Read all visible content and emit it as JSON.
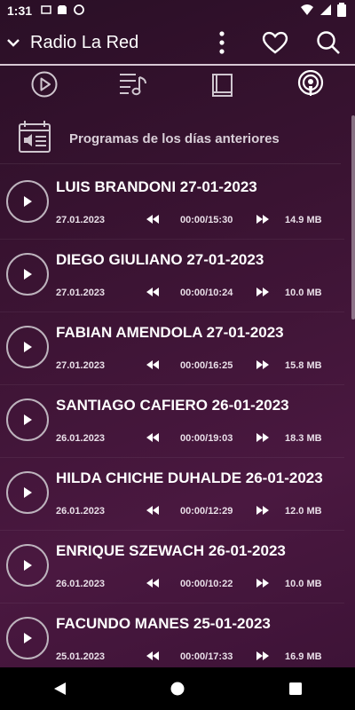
{
  "status_bar": {
    "time": "1:31"
  },
  "app_bar": {
    "title": "Radio La Red"
  },
  "section": {
    "label": "Programas de los días anteriores"
  },
  "items": [
    {
      "title": "LUIS BRANDONI 27-01-2023",
      "date": "27.01.2023",
      "time": "00:00/15:30",
      "size": "14.9 MB"
    },
    {
      "title": "DIEGO GIULIANO 27-01-2023",
      "date": "27.01.2023",
      "time": "00:00/10:24",
      "size": "10.0 MB"
    },
    {
      "title": "FABIAN AMENDOLA 27-01-2023",
      "date": "27.01.2023",
      "time": "00:00/16:25",
      "size": "15.8 MB"
    },
    {
      "title": "SANTIAGO CAFIERO 26-01-2023",
      "date": "26.01.2023",
      "time": "00:00/19:03",
      "size": "18.3 MB"
    },
    {
      "title": "HILDA CHICHE DUHALDE 26-01-2023",
      "date": "26.01.2023",
      "time": "00:00/12:29",
      "size": "12.0 MB"
    },
    {
      "title": "ENRIQUE SZEWACH 26-01-2023",
      "date": "26.01.2023",
      "time": "00:00/10:22",
      "size": "10.0 MB"
    },
    {
      "title": "FACUNDO MANES 25-01-2023",
      "date": "25.01.2023",
      "time": "00:00/17:33",
      "size": "16.9 MB"
    }
  ],
  "icons": {
    "app_bar": [
      "chevron-down-icon",
      "more-vert-icon",
      "heart-icon",
      "search-icon"
    ],
    "tabs": [
      "play-circle-icon",
      "playlist-music-icon",
      "book-icon",
      "podcast-icon"
    ],
    "nav": [
      "back-icon",
      "home-icon",
      "recents-icon"
    ]
  }
}
